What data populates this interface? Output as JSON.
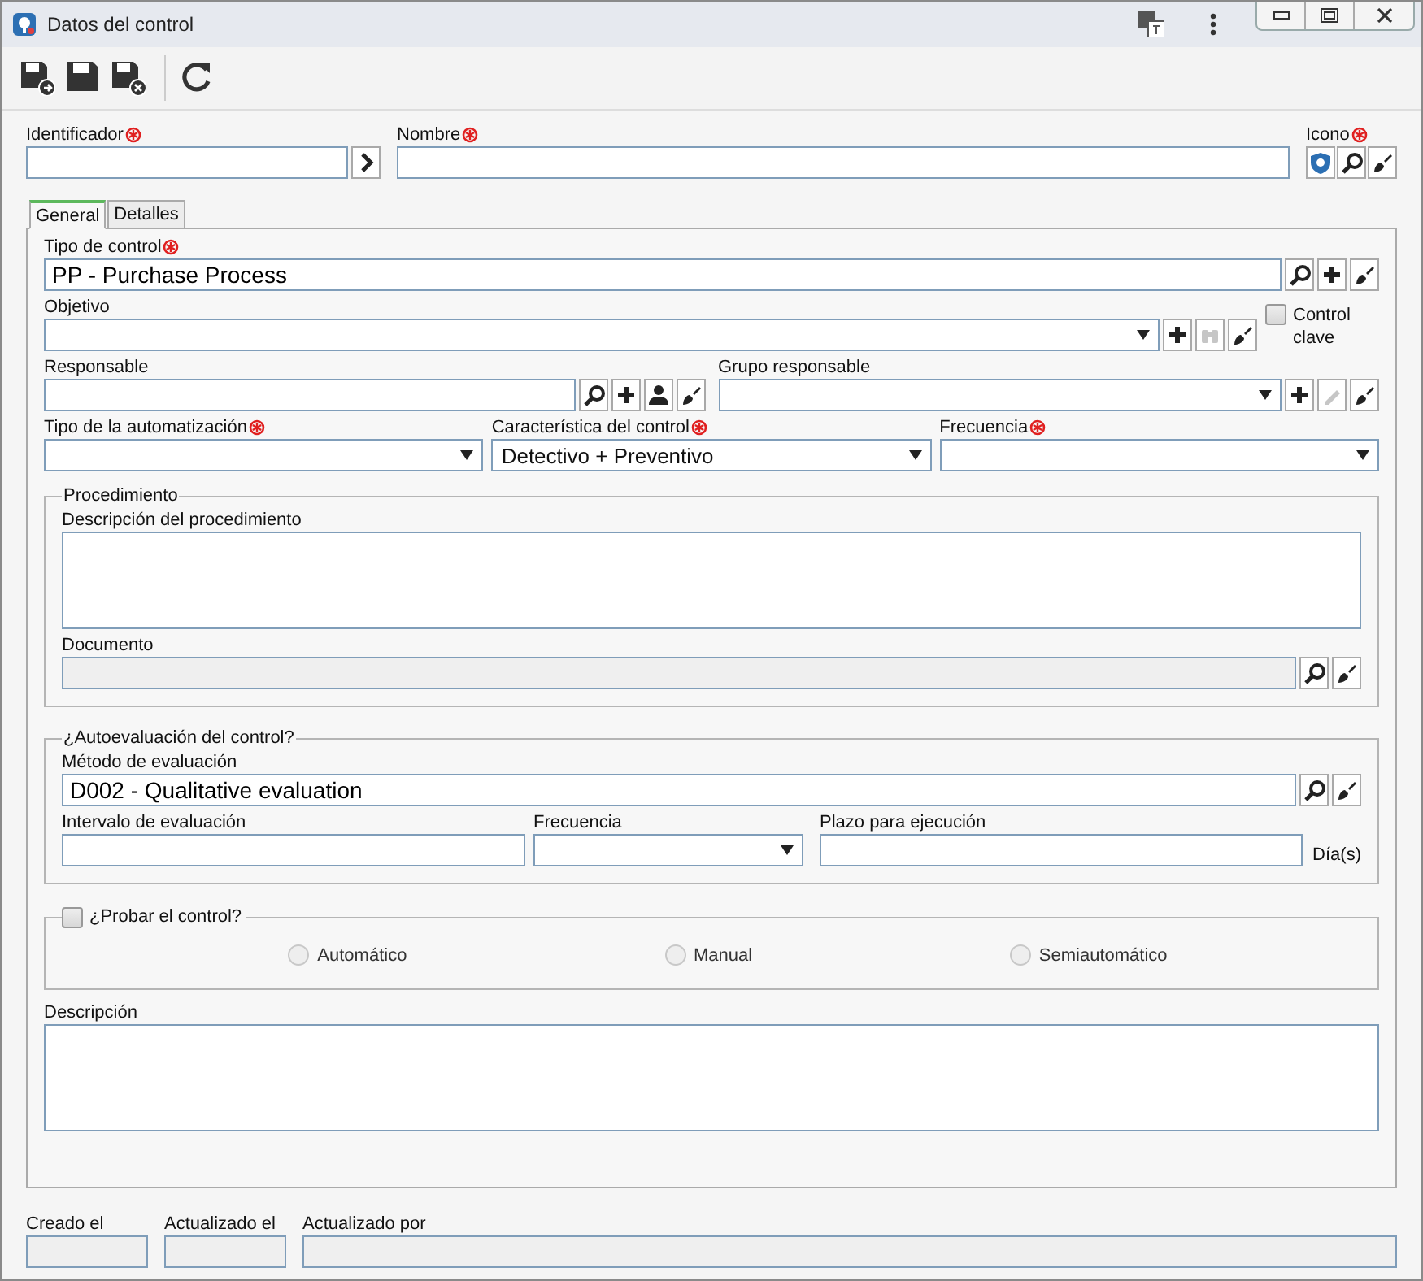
{
  "window": {
    "title": "Datos del control"
  },
  "toolbar": [
    {
      "kind": "save-new"
    },
    {
      "kind": "save"
    },
    {
      "kind": "save-close"
    },
    {
      "kind": "separator"
    },
    {
      "kind": "refresh"
    }
  ],
  "header": [
    {
      "label": "Identificador",
      "required": true,
      "kind": "text",
      "buttons": [
        {
          "kind": "arrow",
          "disabled": false
        }
      ]
    },
    {
      "label": "Nombre",
      "required": true,
      "kind": "text"
    },
    {
      "label": "Icono",
      "required": true,
      "kind": "iconpick",
      "buttons": [
        {
          "kind": "shield",
          "disabled": false
        },
        {
          "kind": "search",
          "disabled": false
        },
        {
          "kind": "brush",
          "disabled": false
        }
      ]
    }
  ],
  "tabs": [
    {
      "label": "General",
      "selected": true
    },
    {
      "label": "Detalles",
      "selected": false
    }
  ],
  "general": [
    {
      "kind": "row",
      "fields": [
        {
          "label": "Tipo de control",
          "required": true,
          "kind": "text",
          "large": true,
          "value": "PP - Purchase Process",
          "buttons": [
            {
              "kind": "search",
              "disabled": false
            },
            {
              "kind": "plus",
              "disabled": false
            },
            {
              "kind": "brush",
              "disabled": false
            }
          ]
        }
      ]
    },
    {
      "kind": "row",
      "fields": [
        {
          "label": "Objetivo",
          "required": false,
          "kind": "select",
          "buttons": [
            {
              "kind": "plus",
              "disabled": false
            },
            {
              "kind": "binoculars",
              "disabled": true
            },
            {
              "kind": "brush",
              "disabled": false
            }
          ]
        },
        {
          "kind": "checkbox",
          "label": "Control clave",
          "checked": false
        }
      ]
    },
    {
      "kind": "row",
      "fields": [
        {
          "label": "Responsable",
          "required": false,
          "kind": "text",
          "buttons": [
            {
              "kind": "search",
              "disabled": false
            },
            {
              "kind": "plus",
              "disabled": false
            },
            {
              "kind": "person",
              "disabled": false
            },
            {
              "kind": "brush",
              "disabled": false
            }
          ]
        },
        {
          "label": "Grupo responsable",
          "required": false,
          "kind": "select",
          "buttons": [
            {
              "kind": "plus",
              "disabled": false
            },
            {
              "kind": "pencil",
              "disabled": true
            },
            {
              "kind": "brush",
              "disabled": false
            }
          ]
        }
      ]
    },
    {
      "kind": "row",
      "fields": [
        {
          "label": "Tipo de la automatización",
          "required": true,
          "kind": "select"
        },
        {
          "label": "Característica del control",
          "required": true,
          "kind": "select",
          "value": "Detectivo + Preventivo"
        },
        {
          "label": "Frecuencia",
          "required": true,
          "kind": "select"
        }
      ]
    },
    {
      "kind": "group",
      "legend": "Procedimiento",
      "rows": [
        {
          "fields": [
            {
              "label": "Descripción del procedimiento",
              "required": false,
              "kind": "textarea"
            }
          ]
        },
        {
          "fields": [
            {
              "label": "Documento",
              "required": false,
              "kind": "text",
              "readonly": true,
              "buttons": [
                {
                  "kind": "search",
                  "disabled": false
                },
                {
                  "kind": "brush",
                  "disabled": false
                }
              ]
            }
          ]
        }
      ]
    },
    {
      "kind": "group",
      "legend": "¿Autoevaluación del control?",
      "rows": [
        {
          "fields": [
            {
              "label": "Método de evaluación",
              "required": false,
              "kind": "text",
              "large": true,
              "value": "D002 - Qualitative evaluation",
              "buttons": [
                {
                  "kind": "search",
                  "disabled": false
                },
                {
                  "kind": "brush",
                  "disabled": false
                }
              ]
            }
          ]
        },
        {
          "fields": [
            {
              "label": "Intervalo de evaluación",
              "required": false,
              "kind": "text"
            },
            {
              "label": "Frecuencia",
              "required": false,
              "kind": "select"
            },
            {
              "label": "Plazo para ejecución",
              "required": false,
              "kind": "text",
              "suffix": "Día(s)"
            }
          ]
        }
      ]
    },
    {
      "kind": "checkgroup",
      "legend": "¿Probar el control?",
      "checked": false,
      "options": [
        {
          "label": "Automático",
          "selected": false
        },
        {
          "label": "Manual",
          "selected": false
        },
        {
          "label": "Semiautomático",
          "selected": false
        }
      ]
    },
    {
      "kind": "row",
      "fields": [
        {
          "label": "Descripción",
          "required": false,
          "kind": "textarea"
        }
      ]
    }
  ],
  "footer": [
    {
      "label": "Creado el",
      "kind": "text",
      "readonly": true
    },
    {
      "label": "Actualizado el",
      "kind": "text",
      "readonly": true
    },
    {
      "label": "Actualizado por",
      "kind": "text",
      "readonly": true
    }
  ]
}
